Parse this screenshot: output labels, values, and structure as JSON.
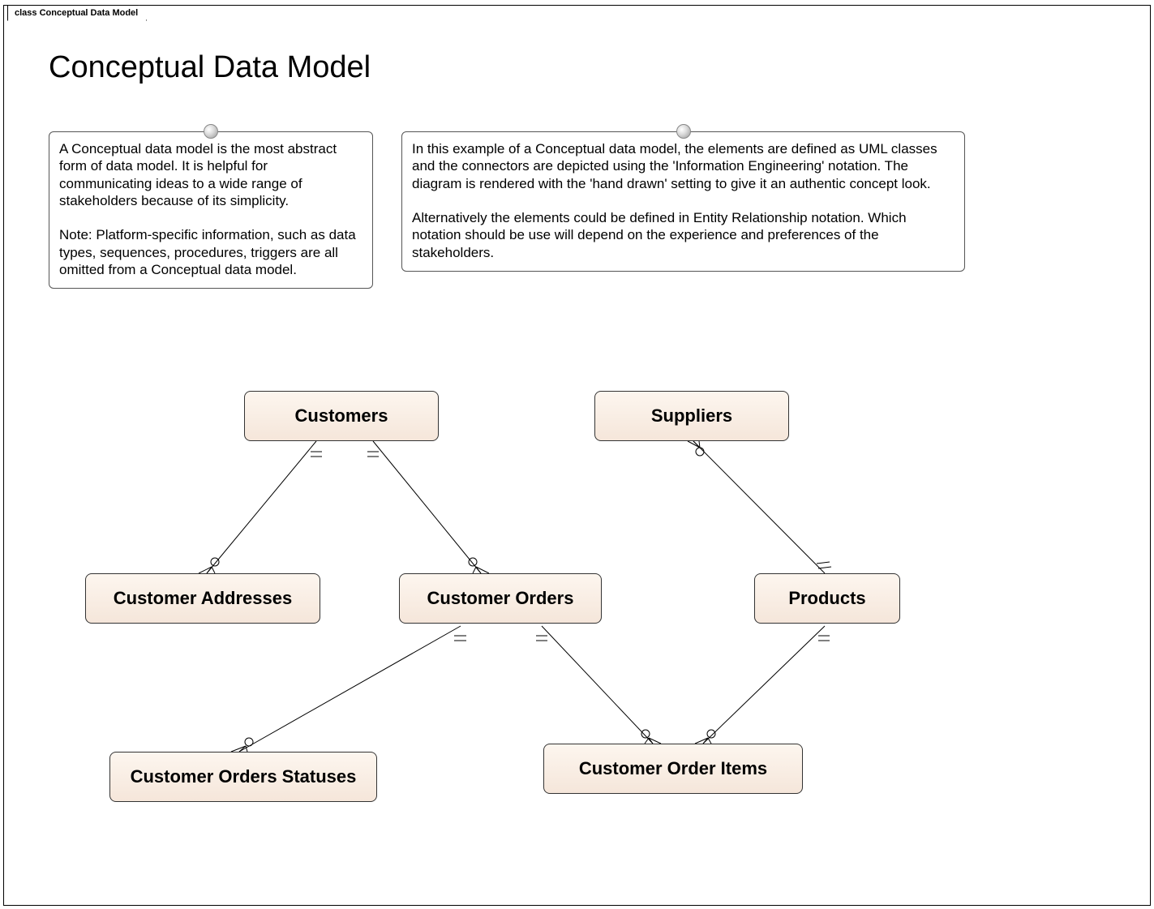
{
  "tab": {
    "prefix": "class",
    "name": "Conceptual Data Model"
  },
  "title": "Conceptual Data Model",
  "notes": {
    "left": "A Conceptual data model is the most abstract form of data model. It is helpful for communicating ideas to a wide range of stakeholders because of its simplicity.\n\nNote: Platform-specific information, such as data types, sequences, procedures, triggers are all omitted from a Conceptual data model.",
    "right": "In this example of a Conceptual data model, the elements are defined as UML classes and the connectors are depicted using the 'Information Engineering' notation.  The diagram is rendered with the 'hand drawn' setting to give it an authentic concept look.\n\nAlternatively  the elements could be defined in Entity Relationship notation. Which notation should be use will depend on the experience and preferences of the stakeholders."
  },
  "entities": {
    "customers": "Customers",
    "suppliers": "Suppliers",
    "customer_addresses": "Customer Addresses",
    "customer_orders": "Customer Orders",
    "products": "Products",
    "customer_orders_statuses": "Customer Orders Statuses",
    "customer_order_items": "Customer Order Items"
  },
  "relationships": [
    {
      "from": "Customers",
      "to": "Customer Addresses",
      "from_card": "one",
      "to_card": "zero-or-many"
    },
    {
      "from": "Customers",
      "to": "Customer Orders",
      "from_card": "one",
      "to_card": "zero-or-many"
    },
    {
      "from": "Suppliers",
      "to": "Products",
      "from_card": "zero-or-many",
      "to_card": "one"
    },
    {
      "from": "Customer Orders",
      "to": "Customer Orders Statuses",
      "from_card": "one",
      "to_card": "zero-or-many"
    },
    {
      "from": "Customer Orders",
      "to": "Customer Order Items",
      "from_card": "one",
      "to_card": "zero-or-many"
    },
    {
      "from": "Products",
      "to": "Customer Order Items",
      "from_card": "one",
      "to_card": "zero-or-many"
    }
  ]
}
